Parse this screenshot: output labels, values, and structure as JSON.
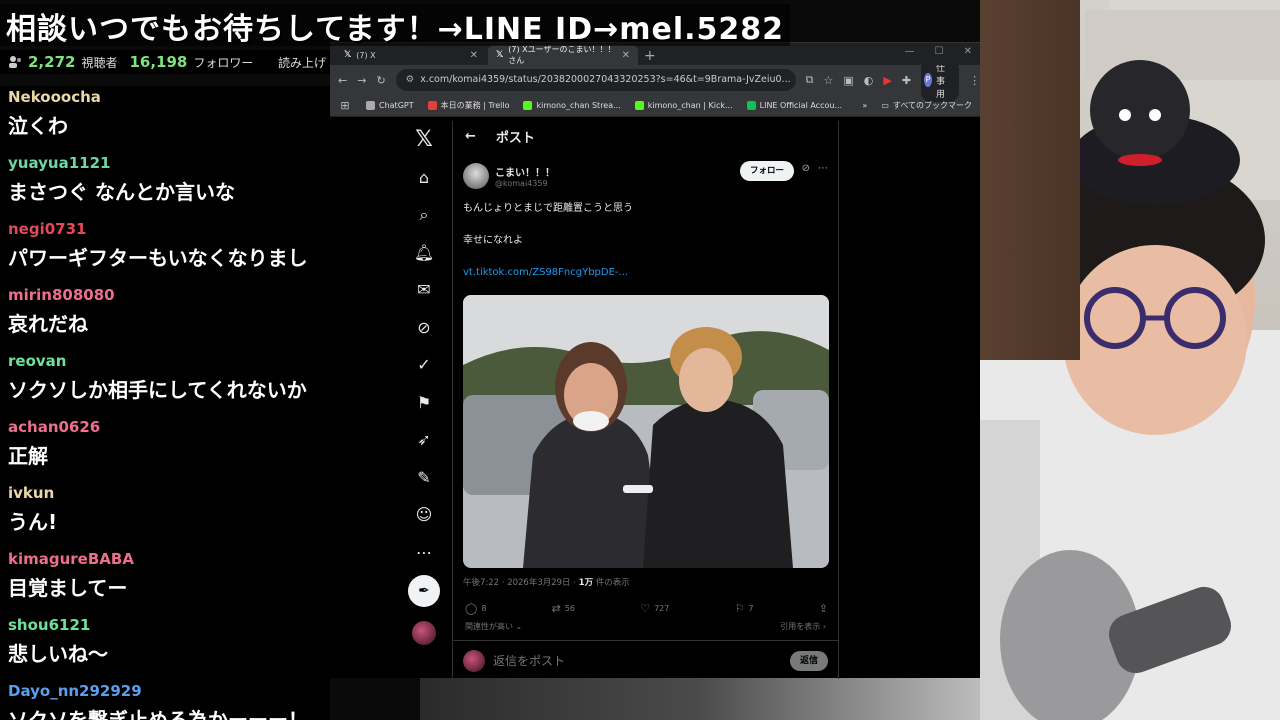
{
  "banner": {
    "text": "相談いつでもお待ちしてます！→LINE ID→mel.5282"
  },
  "stats": {
    "viewers": "2,272",
    "viewers_label": "視聴者",
    "followers": "16,198",
    "followers_label": "フォロワー",
    "read_label": "読み上げ"
  },
  "chat": {
    "messages": [
      {
        "user": "Nekooocha",
        "color": "#e8d9a8",
        "text": "泣くわ"
      },
      {
        "user": "yuayua1121",
        "color": "#6fd6a7",
        "text": "まさつぐ なんとか言いな"
      },
      {
        "user": "negi0731",
        "color": "#e04b57",
        "text": "パワーギフターもいなくなりまし"
      },
      {
        "user": "mirin808080",
        "color": "#ee6e8e",
        "text": "哀れだね"
      },
      {
        "user": "reovan",
        "color": "#6fe09a",
        "text": "ソクソしか相手にしてくれないか"
      },
      {
        "user": "achan0626",
        "color": "#ee6e8e",
        "text": "正解"
      },
      {
        "user": "ivkun",
        "color": "#e8d9a8",
        "text": "うん!"
      },
      {
        "user": "kimagureBABA",
        "color": "#ee6e8e",
        "text": "目覚ましてー"
      },
      {
        "user": "shou6121",
        "color": "#6fe09a",
        "text": "悲しいね〜"
      },
      {
        "user": "Dayo_nn292929",
        "color": "#5aa0ee",
        "text": "ソクソを繋ぎ止める為かーーー！"
      }
    ]
  },
  "browser": {
    "tabs": [
      {
        "label": "(7) X"
      },
      {
        "label": "(7) Xユーザーのこまい！！！さん"
      }
    ],
    "url": "x.com/komai4359/status/2038200027043320253?s=46&t=9Brama-JvZeiu0...",
    "profile_label": "仕事用",
    "bookmarks": [
      {
        "label": "ChatGPT",
        "color": "#aaaaaa"
      },
      {
        "label": "本日の業務 | Trello",
        "color": "#e0413a"
      },
      {
        "label": "kimono_chan Strea...",
        "color": "#53fc18"
      },
      {
        "label": "kimono_chan | Kick...",
        "color": "#53fc18"
      },
      {
        "label": "LINE Official Accou...",
        "color": "#06c755"
      }
    ],
    "all_bookmarks": "すべてのブックマーク"
  },
  "post": {
    "header_title": "ポスト",
    "author_name": "こまい！！！",
    "author_handle": "@komai4359",
    "follow_label": "フォロー",
    "line1": "もんじょりとまじで距離置こうと思う",
    "line2": "幸せになれよ",
    "link": "vt.tiktok.com/ZS98FncgYbpDE-...",
    "timestamp": "午後7:22 · 2026年3月29日 · ",
    "views_count": "1万",
    "views_label": " 件の表示",
    "replies": "8",
    "reposts": "56",
    "likes": "727",
    "bookmarks": "7",
    "relevance": "関連性が高い",
    "quotes": "引用を表示",
    "reply_placeholder": "返信をポスト",
    "reply_button": "返信"
  }
}
